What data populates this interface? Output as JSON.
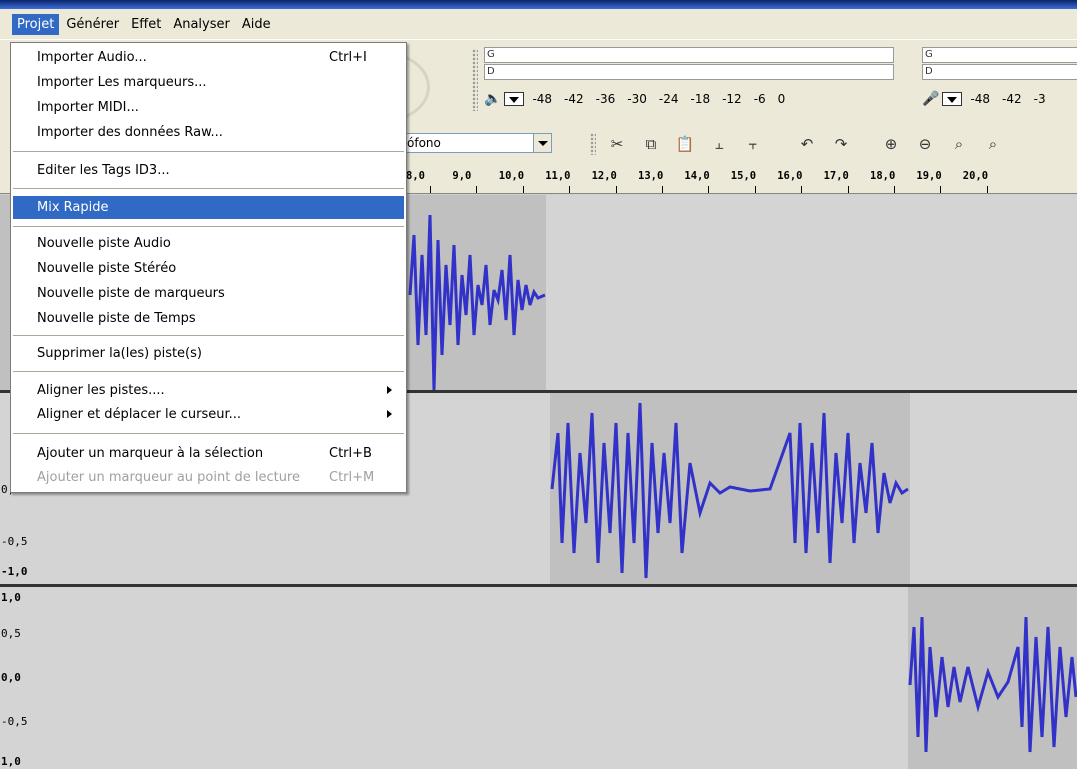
{
  "menubar": {
    "items": [
      "Projet",
      "Générer",
      "Effet",
      "Analyser",
      "Aide"
    ],
    "active_index": 0
  },
  "dropdown": {
    "items": [
      {
        "label": "Importer Audio...",
        "shortcut": "Ctrl+I"
      },
      {
        "label": "Importer Les marqueurs..."
      },
      {
        "label": "Importer MIDI..."
      },
      {
        "label": "Importer des données Raw..."
      },
      {
        "label": "Editer les Tags ID3..."
      },
      {
        "label": "Mix Rapide"
      },
      {
        "label": "Nouvelle piste Audio"
      },
      {
        "label": "Nouvelle piste Stéréo"
      },
      {
        "label": "Nouvelle piste de marqueurs"
      },
      {
        "label": "Nouvelle piste de Temps"
      },
      {
        "label": "Supprimer la(les) piste(s)"
      },
      {
        "label": "Aligner les pistes...."
      },
      {
        "label": "Aligner et déplacer le curseur..."
      },
      {
        "label": "Ajouter un marqueur à  la sélection",
        "shortcut": "Ctrl+B"
      },
      {
        "label": "Ajouter un marqueur au point de lecture",
        "shortcut": "Ctrl+M"
      }
    ],
    "highlighted": "Mix Rapide",
    "disabled": [
      "Ajouter un marqueur au point de lecture"
    ]
  },
  "meters": {
    "output": {
      "g": "G",
      "d": "D",
      "scale": [
        "-48",
        "-42",
        "-36",
        "-30",
        "-24",
        "-18",
        "-12",
        "-6",
        "0"
      ]
    },
    "input": {
      "g": "G",
      "d": "D",
      "scale": [
        "-48",
        "-42",
        "-3"
      ]
    }
  },
  "device_select": {
    "value": "ófono"
  },
  "ruler": {
    "labels": [
      "8,0",
      "9,0",
      "10,0",
      "11,0",
      "12,0",
      "13,0",
      "14,0",
      "15,0",
      "16,0",
      "17,0",
      "18,0",
      "19,0",
      "20,0"
    ]
  },
  "tracks": {
    "track2_labels": [
      "0,0",
      "-0,5",
      "-1,0"
    ],
    "track3_labels": [
      "1,0",
      "0,5",
      "0,0",
      "-0,5",
      "1,0"
    ]
  },
  "colors": {
    "selection": "#316ac5",
    "wave_dark": "#3232c8",
    "wave_light": "#6464dc",
    "track_bg": "#d4d4d4",
    "clip_bg": "#c0c0c0"
  },
  "icons": {
    "speaker": "speaker-icon",
    "microphone": "microphone-icon",
    "trim": "trim-icon",
    "silence": "silence-icon",
    "undo": "undo-icon",
    "redo": "redo-icon",
    "zoom_in": "zoom-in-icon",
    "zoom_out": "zoom-out-icon"
  }
}
